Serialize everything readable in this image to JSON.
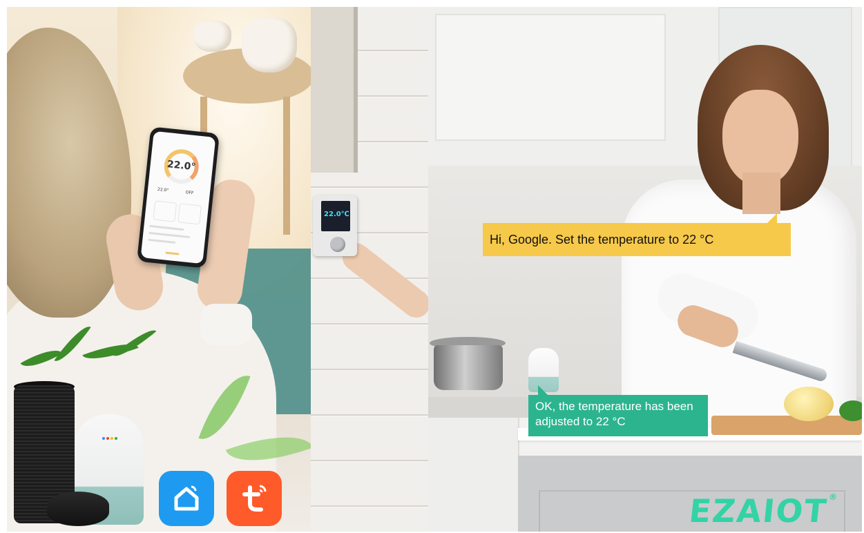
{
  "scene": {
    "thermostat_display": "22.0℃",
    "phone": {
      "temperature": "22.0°",
      "current_temp": "22.0°",
      "mode": "OFF"
    },
    "speech": {
      "question": "Hi, Google. Set the temperature to 22 °C",
      "answer": "OK, the temperature has been adjusted to 22 °C"
    },
    "apps": [
      {
        "name": "smart-home-app",
        "icon": "home-icon",
        "color": "#1e9bf0"
      },
      {
        "name": "tuya-app",
        "icon": "tuya-t-icon",
        "color": "#ff5a2a"
      }
    ],
    "brand": "EZAIOT",
    "brand_mark": "®",
    "colors": {
      "question_bubble": "#f6c94a",
      "answer_bubble": "#2cb48f",
      "brand": "#33d3a6"
    }
  }
}
